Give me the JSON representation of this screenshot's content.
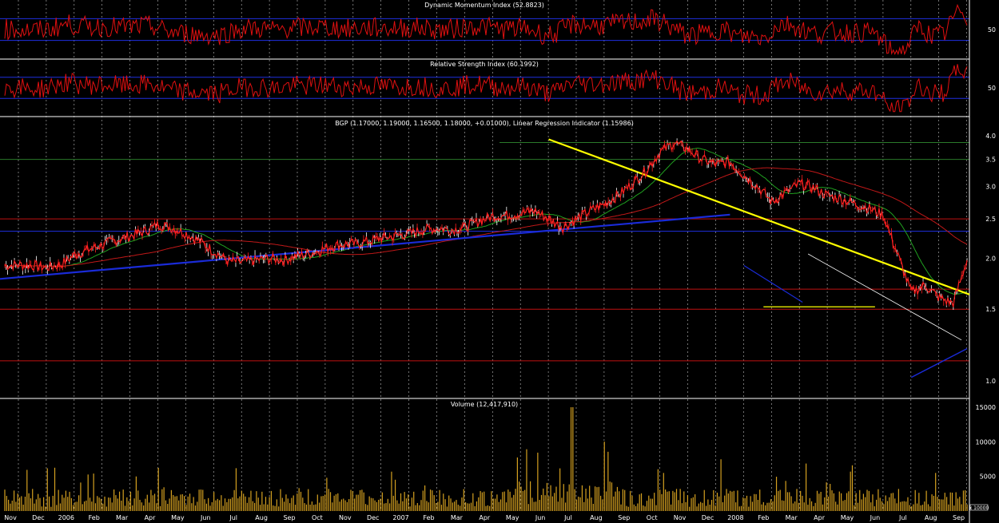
{
  "chart_data": {
    "type": "line",
    "months": [
      "Nov",
      "Dec",
      "2006",
      "Feb",
      "Mar",
      "Apr",
      "May",
      "Jun",
      "Jul",
      "Aug",
      "Sep",
      "Oct",
      "Nov",
      "Dec",
      "2007",
      "Feb",
      "Mar",
      "Apr",
      "May",
      "Jun",
      "Jul",
      "Aug",
      "Sep",
      "Oct",
      "Nov",
      "Dec",
      "2008",
      "Feb",
      "Mar",
      "Apr",
      "May",
      "Jun",
      "Jul",
      "Aug",
      "Sep"
    ],
    "colors": {
      "background": "#000000",
      "price": "#ff2020",
      "ma_short": "#20a020",
      "ma_long": "#c01818",
      "trendline_blue": "#1a2bd8",
      "trendline_yellow": "#ffff00",
      "volume": "#d4a020",
      "oscillator": "#e01010",
      "reference_blue": "#1f2fe0",
      "reference_red": "#c01010",
      "grid": "#ffffff"
    },
    "panels": [
      {
        "id": "dmi",
        "title": "Dynamic Momentum Index (52.8823)",
        "yticks": [
          "50"
        ],
        "reference_levels": [
          70,
          30
        ]
      },
      {
        "id": "rsi",
        "title": "Relative Strength Index (60.1992)",
        "yticks": [
          "50"
        ],
        "reference_levels": [
          70,
          30
        ]
      },
      {
        "id": "price",
        "title": "BGP (1.17000, 1.19000, 1.16500, 1.18000, +0.01000), Linear Regression Indicator (1.15986)",
        "yticks": [
          "4.0",
          "3.5",
          "3.0",
          "2.5",
          "2.0",
          "1.5",
          "1.0"
        ],
        "ylim": [
          0.95,
          4.2
        ],
        "scale": "log",
        "horizontal_levels_red": [
          2.5,
          1.68,
          1.5,
          1.12
        ],
        "horizontal_levels_blue": [
          2.33
        ],
        "horizontal_levels_green": [
          3.85,
          3.5
        ],
        "series": [
          {
            "name": "BGP",
            "x": [
              0,
              0.5,
              1,
              1.5,
              2,
              2.5,
              3,
              3.5,
              4,
              4.5,
              5,
              5.5,
              6,
              6.5,
              7,
              7.5,
              8,
              8.5,
              9,
              9.5,
              10,
              10.5,
              11,
              11.5,
              12,
              12.5,
              13,
              13.5,
              14,
              14.5,
              15,
              15.5,
              16,
              16.5,
              17,
              17.5,
              18,
              18.5,
              19,
              19.5,
              20,
              20.5,
              21,
              21.5,
              22,
              22.5,
              23,
              23.5,
              24,
              24.5,
              25,
              25.5,
              26,
              26.5,
              27,
              27.5,
              28,
              28.5,
              29,
              29.5,
              30,
              30.5,
              31,
              31.5,
              32,
              32.5,
              33,
              33.5,
              34,
              34.5
            ],
            "y": [
              1.92,
              1.93,
              1.92,
              1.9,
              1.93,
              2.04,
              2.1,
              2.16,
              2.22,
              2.27,
              2.33,
              2.42,
              2.38,
              2.3,
              2.2,
              2.08,
              1.97,
              1.96,
              1.98,
              2.0,
              1.98,
              2.03,
              2.06,
              2.12,
              2.16,
              2.17,
              2.2,
              2.24,
              2.27,
              2.3,
              2.35,
              2.37,
              2.35,
              2.38,
              2.47,
              2.54,
              2.55,
              2.58,
              2.62,
              2.5,
              2.38,
              2.5,
              2.62,
              2.72,
              2.86,
              3.05,
              3.3,
              3.65,
              3.85,
              3.7,
              3.5,
              3.4,
              3.45,
              3.2,
              3.0,
              2.75,
              2.9,
              3.05,
              2.98,
              2.85,
              2.8,
              2.72,
              2.65,
              2.55,
              2.05,
              1.65,
              1.72,
              1.6,
              1.55,
              1.98
            ]
          }
        ]
      },
      {
        "id": "volume",
        "title": "Volume (12,417,910)",
        "yticks": [
          "15000",
          "10000",
          "5000"
        ],
        "multiplier_label": "x 10000"
      }
    ]
  }
}
